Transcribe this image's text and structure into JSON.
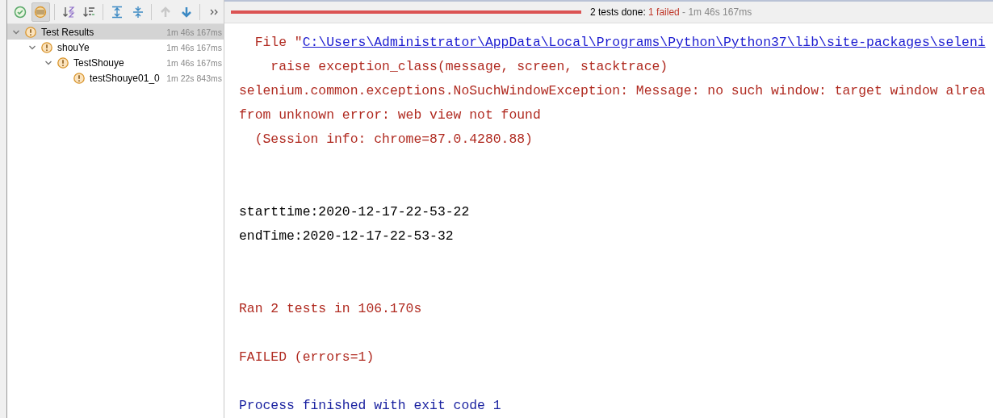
{
  "toolbar": {
    "buttons": [
      {
        "kind": "passed",
        "selected": false
      },
      {
        "kind": "ignored",
        "selected": true
      },
      {
        "kind": "sort-alpha",
        "selected": false
      },
      {
        "kind": "sort-duration",
        "selected": false
      },
      {
        "kind": "expand",
        "selected": false
      },
      {
        "kind": "collapse",
        "selected": false
      },
      {
        "kind": "up",
        "selected": false,
        "disabled": true
      },
      {
        "kind": "down",
        "selected": false,
        "disabled": false
      },
      {
        "kind": "more",
        "selected": false
      }
    ]
  },
  "progress": {
    "level": 1,
    "failed": true
  },
  "status": {
    "done": "2 tests done:",
    "failed": "1 failed",
    "time": "- 1m 46s 167ms"
  },
  "tree": [
    {
      "label": "Test Results",
      "time": "1m 46s 167ms",
      "selected": true,
      "expanded": true,
      "children": [
        {
          "label": "shouYe",
          "time": "1m 46s 167ms",
          "selected": false,
          "expanded": true,
          "children": [
            {
              "label": "TestShouye",
              "time": "1m 46s 167ms",
              "selected": false,
              "expanded": true,
              "children": [
                {
                  "label": "testShouye01_0",
                  "time": "1m 22s 843ms",
                  "selected": false
                }
              ]
            }
          ]
        }
      ]
    }
  ],
  "console": [
    {
      "kind": "file",
      "prefix": "  File \"",
      "link": "C:\\Users\\Administrator\\AppData\\Local\\Programs\\Python\\Python37\\lib\\site-packages\\seleni"
    },
    {
      "kind": "error",
      "text": "    raise exception_class(message, screen, stacktrace)"
    },
    {
      "kind": "error",
      "text": "selenium.common.exceptions.NoSuchWindowException: Message: no such window: target window alrea"
    },
    {
      "kind": "error",
      "text": "from unknown error: web view not found"
    },
    {
      "kind": "error",
      "text": "  (Session info: chrome=87.0.4280.88)"
    },
    {
      "kind": "blank"
    },
    {
      "kind": "blank"
    },
    {
      "kind": "output",
      "text": "starttime:2020-12-17-22-53-22"
    },
    {
      "kind": "output",
      "text": "endTime:2020-12-17-22-53-32"
    },
    {
      "kind": "blank"
    },
    {
      "kind": "blank"
    },
    {
      "kind": "error",
      "text": "Ran 2 tests in 106.170s"
    },
    {
      "kind": "blank"
    },
    {
      "kind": "error",
      "text": "FAILED (errors=1)"
    },
    {
      "kind": "blank"
    },
    {
      "kind": "system",
      "text": "Process finished with exit code 1"
    }
  ]
}
